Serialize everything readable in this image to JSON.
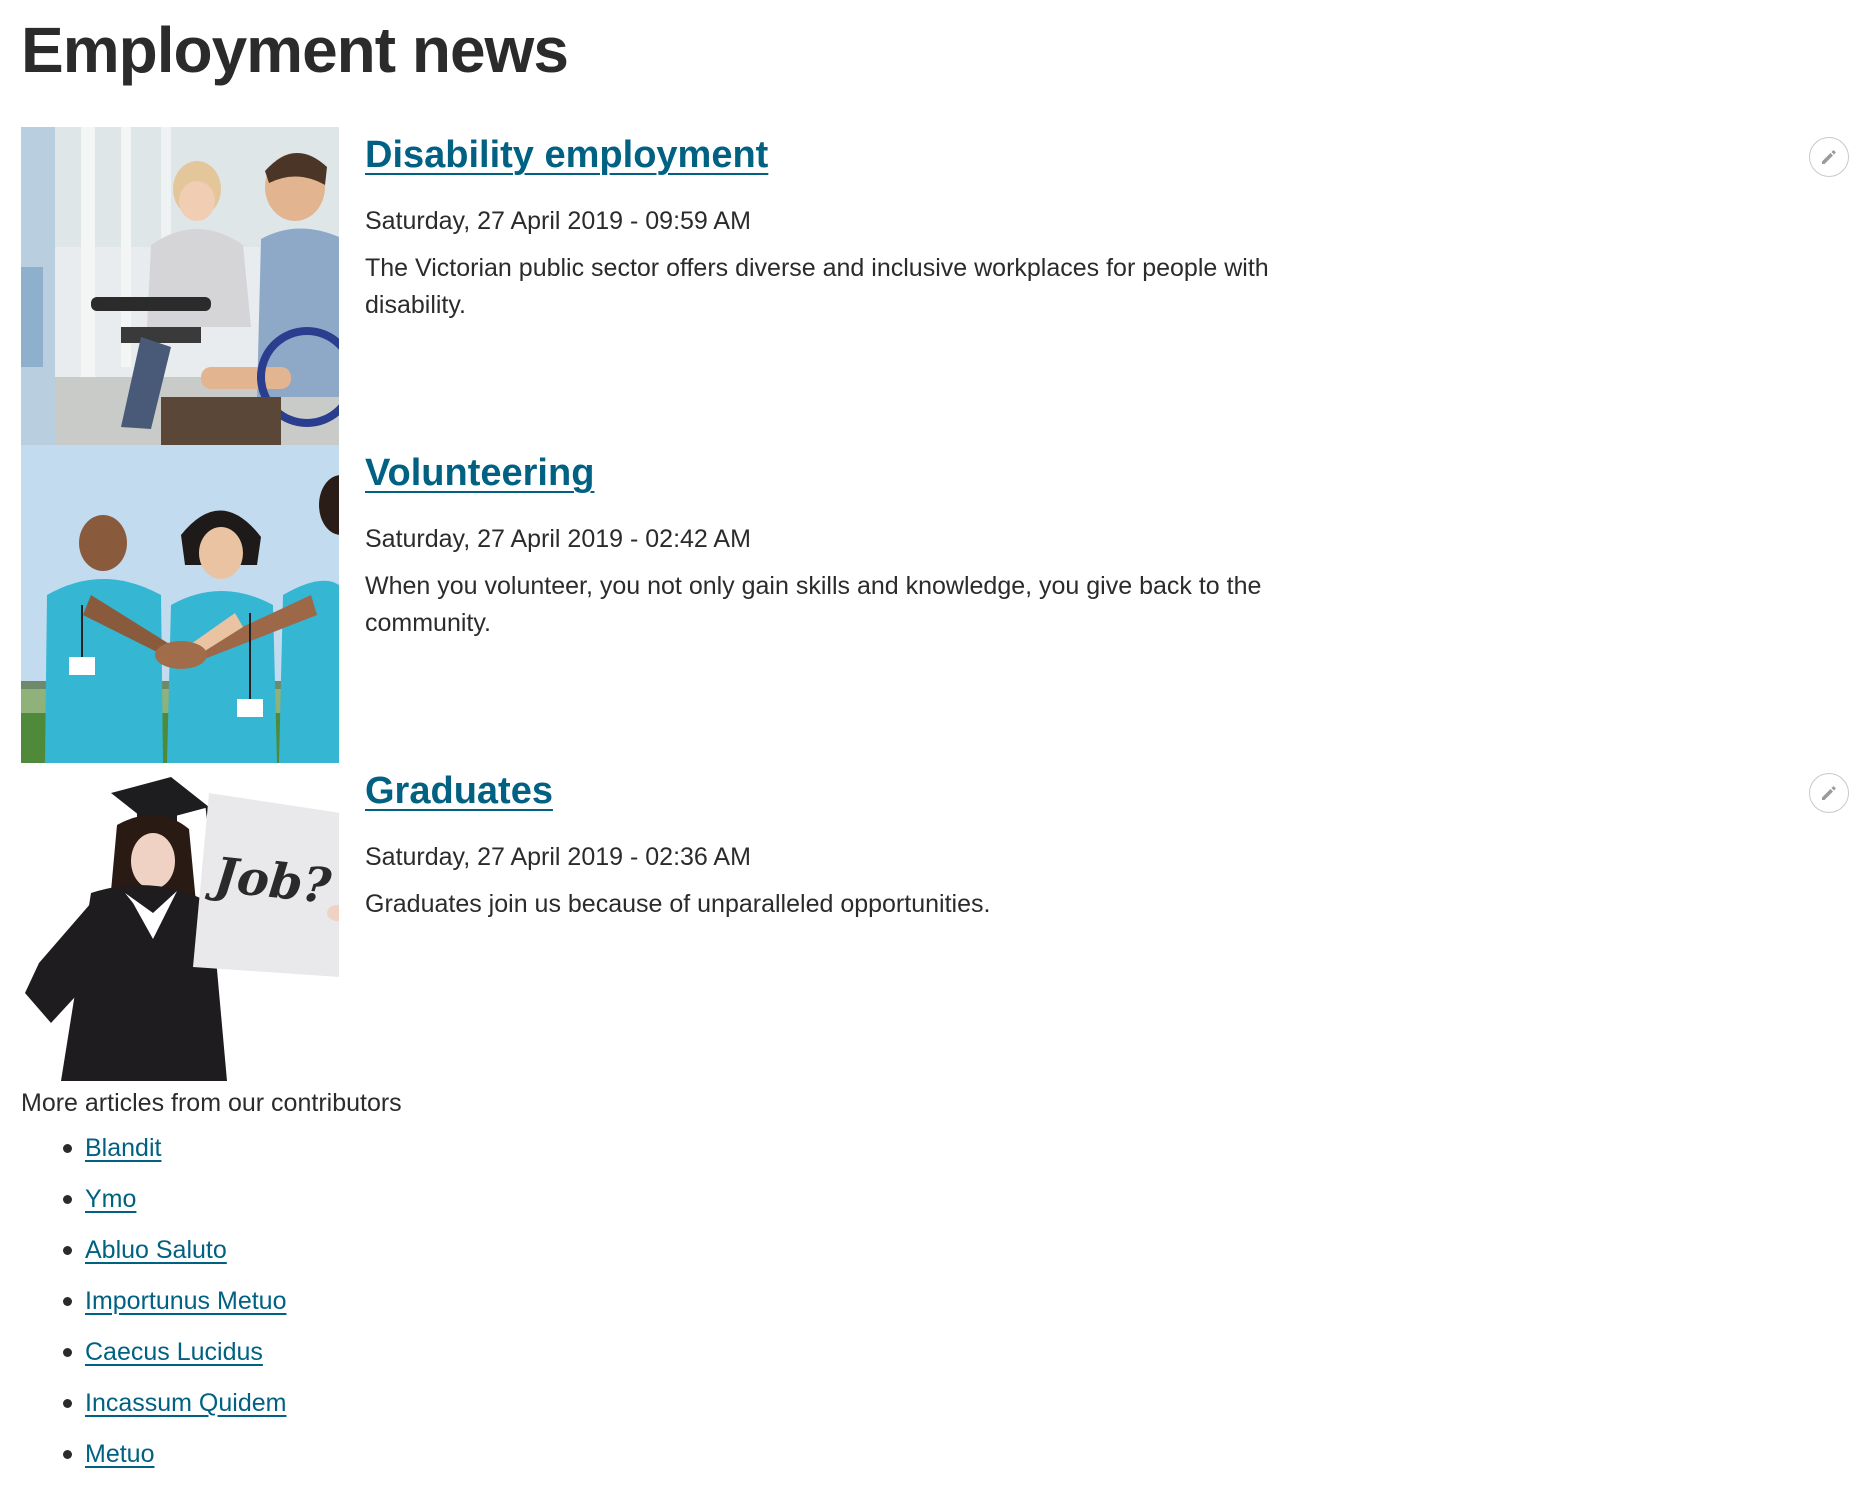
{
  "page": {
    "title": "Employment news"
  },
  "articles": [
    {
      "title": "Disability employment",
      "date": "Saturday, 27 April 2019 - 09:59 AM",
      "summary": "The Victorian public sector offers diverse and inclusive workplaces for people with disability.",
      "image": "photo of people in a meeting, man in wheelchair smiling",
      "editable": true
    },
    {
      "title": "Volunteering",
      "date": "Saturday, 27 April 2019 - 02:42 AM",
      "summary": "When you volunteer, you not only gain skills and knowledge, you give back to the community.",
      "image": "photo of volunteers in blue t-shirts stacking hands",
      "editable": false
    },
    {
      "title": "Graduates",
      "date": "Saturday, 27 April 2019 - 02:36 AM",
      "summary": "Graduates join us because of unparalleled opportunities.",
      "image": "photo of graduate in gown holding sign",
      "sign_text": "Job?",
      "editable": true
    }
  ],
  "contributors": {
    "heading": "More articles from our contributors",
    "items": [
      "Blandit",
      "Ymo",
      "Abluo Saluto",
      "Importunus Metuo",
      "Caecus Lucidus",
      "Incassum Quidem",
      "Metuo"
    ]
  },
  "colors": {
    "link": "#006183",
    "text": "#2b2b2b",
    "volunteer_shirt": "#35b6d2"
  },
  "icons": {
    "edit": "pencil-icon"
  }
}
